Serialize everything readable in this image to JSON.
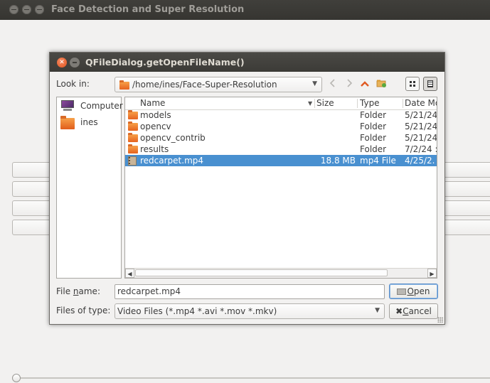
{
  "main_window": {
    "title": "Face Detection and Super Resolution"
  },
  "dialog": {
    "title": "QFileDialog.getOpenFileName()",
    "close_symbol": "✕",
    "look_in_label": "Look in:",
    "current_path": "/home/ines/Face-Super-Resolution",
    "toolbar_icons": [
      "back-arrow-icon",
      "forward-arrow-icon",
      "parent-directory-icon",
      "new-folder-icon",
      "icon-view-icon",
      "detail-view-icon"
    ],
    "sidebar": [
      {
        "label": "Computer",
        "icon": "computer-icon"
      },
      {
        "label": "ines",
        "icon": "home-folder-icon"
      }
    ],
    "columns": {
      "name": "Name",
      "size": "Size",
      "type": "Type",
      "date": "Date Modified"
    },
    "files": [
      {
        "name": "models",
        "size": "",
        "type": "Folder",
        "date": "5/21/24",
        "icon": "folder-icon",
        "selected": false
      },
      {
        "name": "opencv",
        "size": "",
        "type": "Folder",
        "date": "5/21/24",
        "icon": "folder-icon",
        "selected": false
      },
      {
        "name": "opencv_contrib",
        "size": "",
        "type": "Folder",
        "date": "5/21/24",
        "icon": "folder-icon",
        "selected": false
      },
      {
        "name": "results",
        "size": "",
        "type": "Folder",
        "date": "7/2/24 :",
        "icon": "folder-icon",
        "selected": false
      },
      {
        "name": "redcarpet.mp4",
        "size": "18.8 MB",
        "type": "mp4 File",
        "date": "4/25/2.",
        "icon": "video-file-icon",
        "selected": true
      }
    ],
    "file_name_label": "File name:",
    "file_name_label_mnemonic": "n",
    "file_name_value": "redcarpet.mp4",
    "file_type_label": "Files of type:",
    "file_type_value": "Video Files (*.mp4 *.avi *.mov *.mkv)",
    "open_button": "Open",
    "open_mnemonic": "O",
    "cancel_button": "Cancel",
    "cancel_mnemonic": "C"
  },
  "colors": {
    "selection": "#4990d0",
    "titlebar": "#3c3b37",
    "close_button": "#e0531e",
    "folder": "#e6631f"
  }
}
